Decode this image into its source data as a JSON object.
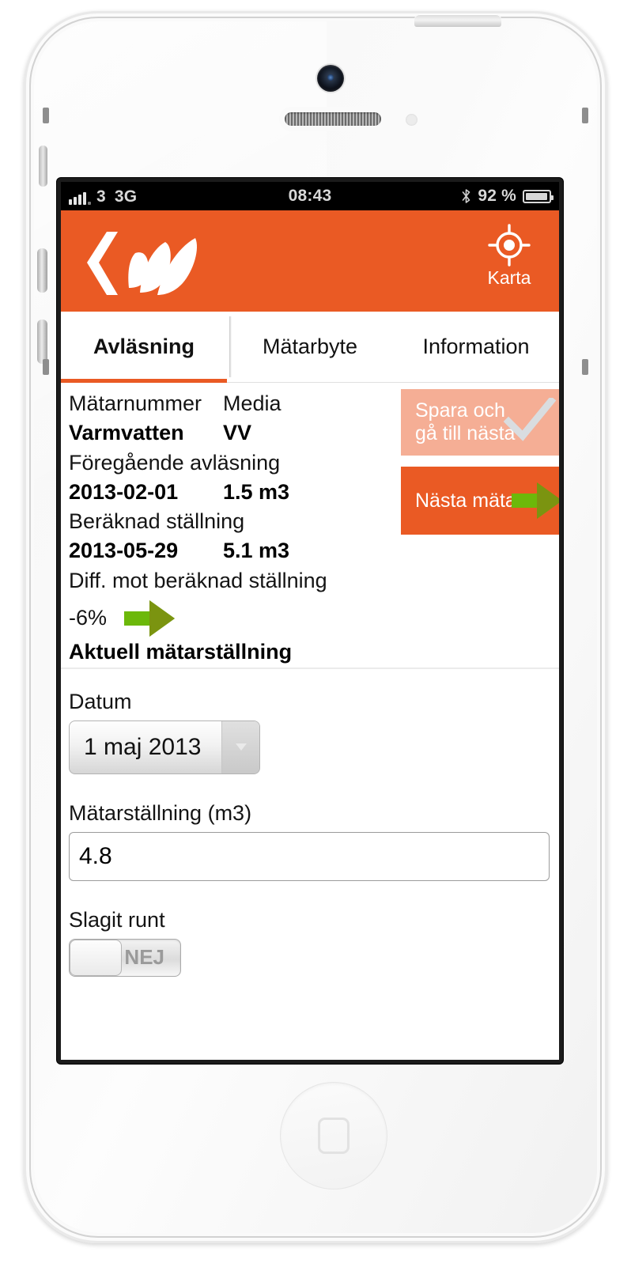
{
  "statusbar": {
    "carrier": "3",
    "network": "3G",
    "time": "08:43",
    "battery_percent": "92 %",
    "bluetooth_icon": "bluetooth-icon",
    "signal_icon": "signal-bars-icon",
    "battery_icon": "battery-icon"
  },
  "header": {
    "logo_icon": "company-logo-icon",
    "map_button_label": "Karta",
    "map_button_icon": "location-target-icon",
    "background_color": "#ea5a24"
  },
  "tabs": [
    {
      "label": "Avläsning",
      "active": true
    },
    {
      "label": "Mätarbyte",
      "active": false
    },
    {
      "label": "Information",
      "active": false
    }
  ],
  "meter_info": {
    "col1_label": "Mätarnummer",
    "col2_label": "Media",
    "col1_value": "Varmvatten",
    "col2_value": "VV",
    "previous_reading_label": "Föregående avläsning",
    "previous_reading_date": "2013-02-01",
    "previous_reading_value": "1.5 m3",
    "estimated_label": "Beräknad ställning",
    "estimated_date": "2013-05-29",
    "estimated_value": "5.1 m3",
    "diff_label": "Diff. mot beräknad ställning",
    "diff_value": "-6%",
    "diff_icon": "green-arrow-right-icon",
    "current_reading_title": "Aktuell mätarställning"
  },
  "actions": {
    "save_label": "Spara och gå till nästa",
    "save_icon": "checkmark-icon",
    "save_color": "#f5ae95",
    "next_label": "Nästa mätare",
    "next_icon": "green-arrow-right-icon",
    "next_color": "#ea5a24"
  },
  "form": {
    "date_label": "Datum",
    "date_value": "1 maj 2013",
    "date_caret_icon": "chevron-down-icon",
    "reading_label": "Mätarställning (m3)",
    "reading_value": "4.8",
    "reading_placeholder": "",
    "rollover_label": "Slagit runt",
    "rollover_state": "NEJ"
  },
  "device": {
    "camera_icon": "front-camera-icon",
    "speaker_icon": "earpiece-speaker-icon",
    "sensor_icon": "proximity-sensor-icon",
    "home_icon": "home-button-icon",
    "power_icon": "power-button-icon",
    "volume_up_icon": "volume-up-button-icon",
    "volume_down_icon": "volume-down-button-icon",
    "mute_icon": "mute-switch-icon"
  }
}
